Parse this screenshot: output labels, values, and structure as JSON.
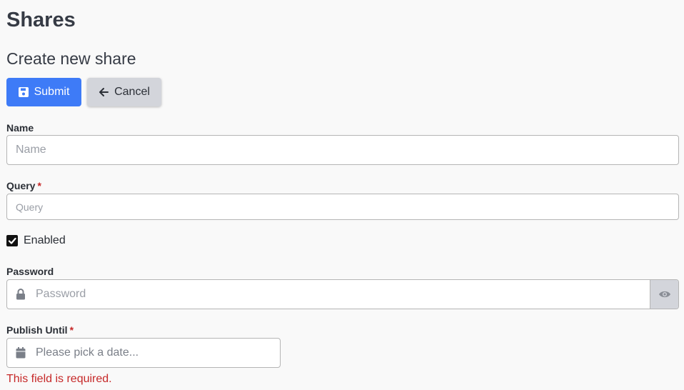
{
  "page": {
    "title": "Shares",
    "section_title": "Create new share"
  },
  "toolbar": {
    "submit_label": "Submit",
    "cancel_label": "Cancel"
  },
  "form": {
    "name": {
      "label": "Name",
      "placeholder": "Name",
      "value": ""
    },
    "query": {
      "label": "Query",
      "required_mark": "*",
      "placeholder": "Query",
      "value": ""
    },
    "enabled": {
      "label": "Enabled",
      "checked": true
    },
    "password": {
      "label": "Password",
      "placeholder": "Password",
      "value": ""
    },
    "publish_until": {
      "label": "Publish Until",
      "required_mark": "*",
      "placeholder": "Please pick a date...",
      "value": "",
      "error": "This field is required."
    }
  },
  "icons": {
    "submit": "save-icon",
    "cancel": "arrow-left-icon",
    "checkbox": "check-icon",
    "password_lead": "lock-icon",
    "password_toggle": "eye-icon",
    "date_lead": "calendar-icon"
  },
  "colors": {
    "primary": "#3e7bf7",
    "secondary": "#d3d5db",
    "error": "#c62828",
    "text": "#363b45"
  }
}
